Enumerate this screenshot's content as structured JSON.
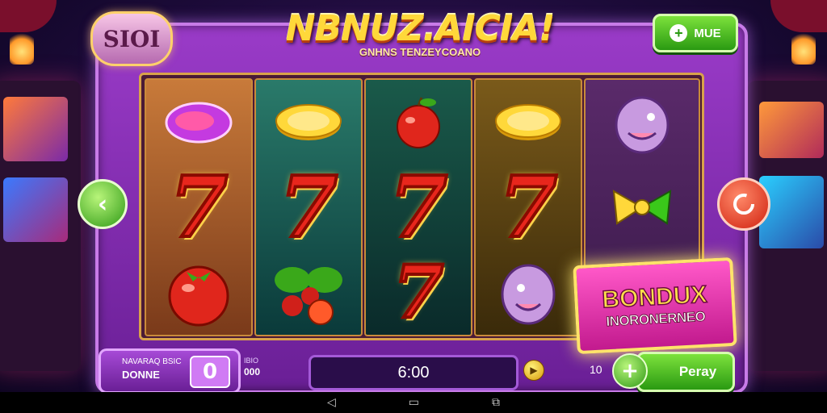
{
  "game": {
    "title": "NBNUZ.AICIA!",
    "subtitle": "GNHNS TENZEYCOANO",
    "logo_text": "SIOI"
  },
  "header": {
    "add_button_label": "MUE"
  },
  "reels": [
    [
      "candy",
      "seven",
      "tomato"
    ],
    [
      "coin",
      "seven",
      "cherries"
    ],
    [
      "apple",
      "seven",
      "seven"
    ],
    [
      "coin",
      "seven",
      "dolphin"
    ],
    [
      "dolphin",
      "bow",
      "bonus"
    ]
  ],
  "bonus_banner": {
    "title": "BONDUX",
    "subtitle": "INORONERNEO"
  },
  "bottom_bar": {
    "balance_small_label": "NAVARAQ BSIC",
    "balance_label": "DONNE",
    "balance_value": "0",
    "bet_small_label": "IBIO",
    "bet_value": "000",
    "timer_text": "6:00",
    "count_value": "10",
    "play_button_label": "Peray"
  },
  "colors": {
    "frame_purple": "#9a3bc8",
    "accent_green": "#2a9a12",
    "seven_red": "#e8261c",
    "gold": "#ffd83a",
    "bonus_pink": "#ff58c8"
  }
}
